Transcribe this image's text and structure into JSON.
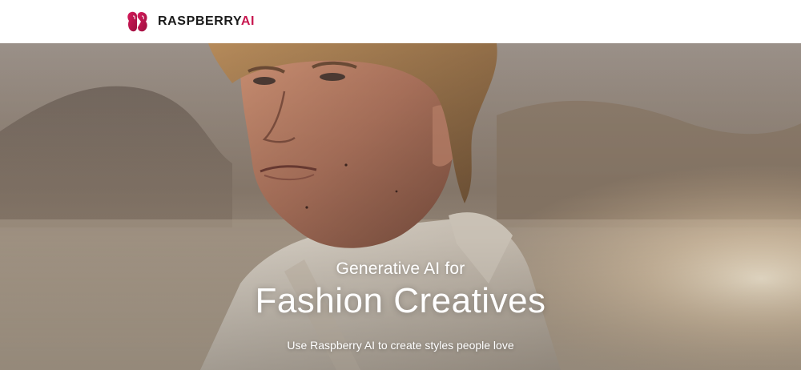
{
  "brand": {
    "name_main": "RASPBERRY",
    "name_accent": "AI",
    "accent_color": "#c8174f"
  },
  "hero": {
    "kicker": "Generative AI for",
    "title": "Fashion Creatives",
    "subtitle": "Use Raspberry AI to create styles people love"
  },
  "icons": {
    "logo": "raspberry-logo-icon"
  }
}
